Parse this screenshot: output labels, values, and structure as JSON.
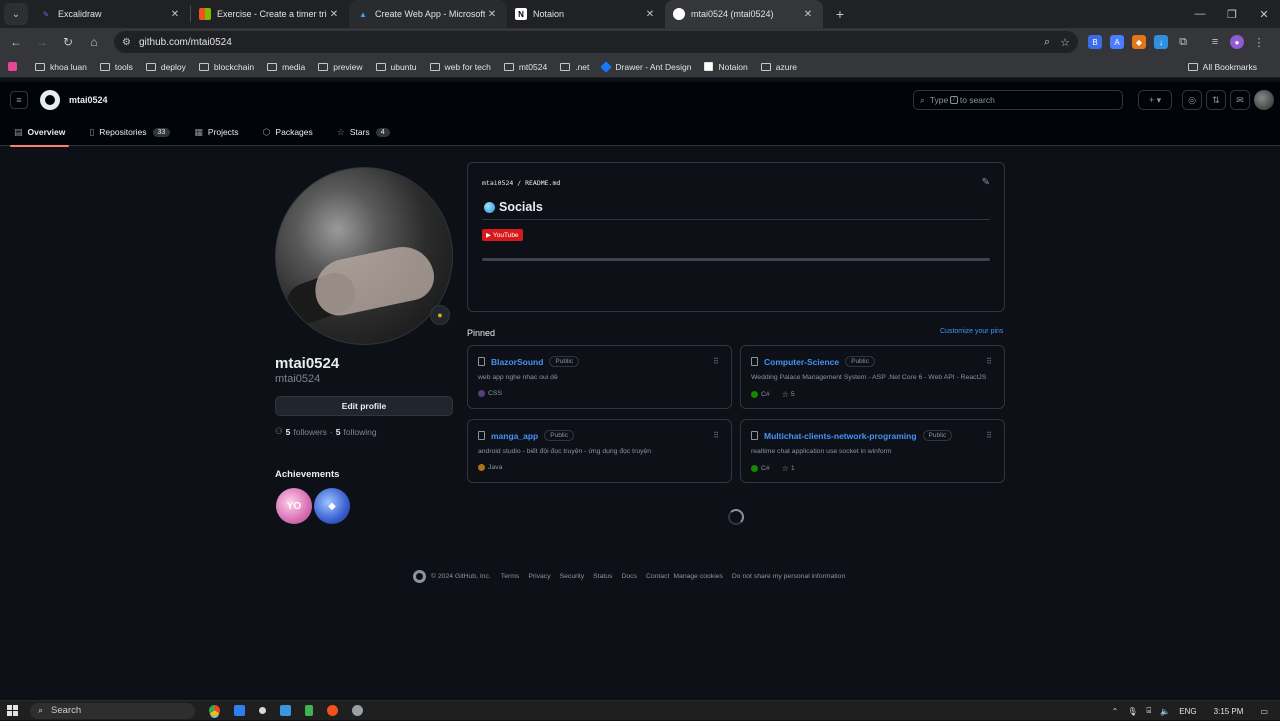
{
  "browser": {
    "tabs": [
      {
        "title": "Excalidraw",
        "icon": "excalidraw-icon",
        "color": "#6965db"
      },
      {
        "title": "Exercise - Create a timer trigger",
        "icon": "microsoft-icon",
        "color": "#f25022"
      },
      {
        "title": "Create Web App - Microsoft Azure",
        "icon": "azure-icon",
        "color": "#0078d4"
      },
      {
        "title": "Notaion",
        "icon": "notion-icon",
        "color": "#ffffff"
      },
      {
        "title": "mtai0524 (mtai0524)",
        "icon": "github-icon",
        "color": "#ffffff"
      }
    ],
    "url": "github.com/mtai0524",
    "bookmarks": [
      "khoa luan",
      "tools",
      "deploy",
      "blockchain",
      "media",
      "preview",
      "ubuntu",
      "web for tech",
      "mt0524",
      ".net",
      "Drawer - Ant Design",
      "Notaion",
      "azure"
    ],
    "all_bookmarks": "All Bookmarks"
  },
  "github": {
    "username": "mtai0524",
    "search_placeholder_pre": "Type",
    "search_key": "/",
    "search_placeholder_post": "to search",
    "nav": [
      {
        "label": "Overview",
        "icon": "book-icon"
      },
      {
        "label": "Repositories",
        "icon": "repo-icon",
        "count": "33"
      },
      {
        "label": "Projects",
        "icon": "table-icon"
      },
      {
        "label": "Packages",
        "icon": "package-icon"
      },
      {
        "label": "Stars",
        "icon": "star-icon",
        "count": "4"
      }
    ]
  },
  "profile": {
    "name": "mtai0524",
    "login": "mtai0524",
    "edit_label": "Edit profile",
    "followers": "5",
    "followers_label": "followers",
    "following": "5",
    "following_label": "following",
    "achievements_title": "Achievements"
  },
  "readme": {
    "path_user": "mtai0524",
    "path_sep": "/",
    "path_file": "README.md",
    "heading": "Socials",
    "youtube_label": "YouTube"
  },
  "pinned": {
    "title": "Pinned",
    "customize": "Customize your pins",
    "repos": [
      {
        "name": "BlazorSound",
        "visibility": "Public",
        "description": "web app nghe nhạc oui dề",
        "language": "CSS",
        "lang_color": "#563d7c",
        "stars": ""
      },
      {
        "name": "Computer-Science",
        "visibility": "Public",
        "description": "Wedding Palace Management System - ASP .Net Core 6 - Web API - ReactJS",
        "language": "C#",
        "lang_color": "#178600",
        "stars": "5"
      },
      {
        "name": "manga_app",
        "visibility": "Public",
        "description": "android studio - biết đội đọc truyện - ứng dụng đọc truyện",
        "language": "Java",
        "lang_color": "#b07219",
        "stars": ""
      },
      {
        "name": "Multichat-clients-network-programing",
        "visibility": "Public",
        "description": "realtime chat application use socket in winform",
        "language": "C#",
        "lang_color": "#178600",
        "stars": "1"
      }
    ]
  },
  "footer": {
    "copyright": "© 2024 GitHub, Inc.",
    "links": [
      "Terms",
      "Privacy",
      "Security",
      "Status",
      "Docs",
      "Contact",
      "Manage cookies",
      "Do not share my personal information"
    ]
  },
  "taskbar": {
    "search_label": "Search",
    "lang": "ENG",
    "time": "3:15 PM"
  }
}
